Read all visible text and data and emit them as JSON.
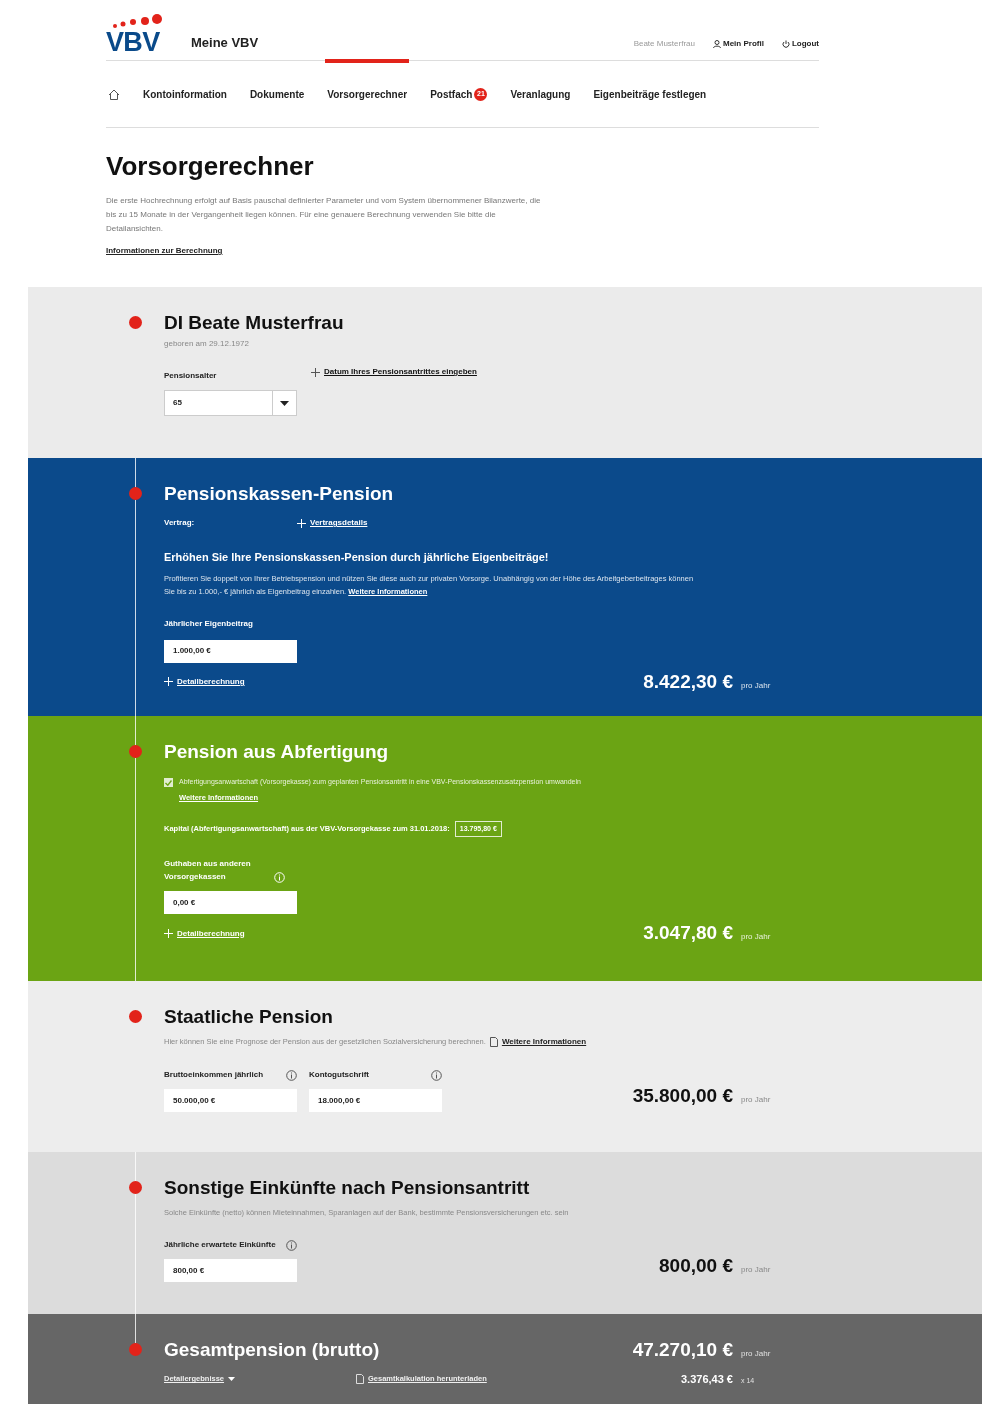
{
  "header": {
    "logo": "VBV",
    "app_title": "Meine VBV",
    "user_name": "Beate Musterfrau",
    "links": [
      {
        "kind": "profile",
        "label": "Mein Profil"
      },
      {
        "kind": "logout",
        "label": "Logout"
      }
    ]
  },
  "nav": [
    {
      "kind": "home",
      "selected": false
    },
    {
      "label": "Kontoinformation",
      "selected": false
    },
    {
      "label": "Dokumente",
      "selected": false
    },
    {
      "label": "Vorsorgerechner",
      "selected": true
    },
    {
      "label": "Postfach",
      "badge": "21",
      "selected": false
    },
    {
      "label": "Veranlagung",
      "selected": false
    },
    {
      "label": "Eigenbeiträge festlegen",
      "selected": false
    }
  ],
  "page": {
    "title": "Vorsorgerechner",
    "intro": "Die erste Hochrechnung erfolgt auf Basis pauschal definierter Parameter und vom System übernommener Bilanzwerte, die bis zu 15 Monate in der Vergangenheit liegen können. Für eine genauere Berechnung verwenden Sie bitte die Detailansichten.",
    "info_link": "Informationen zur Berechnung"
  },
  "sections": [
    {
      "kind": "person",
      "title": "DI Beate Musterfrau",
      "birth": "geboren am 29.12.1972",
      "age_label": "Pensionsalter",
      "age_value": "65",
      "date_link": "Datum Ihres Pensionsantrittes eingeben"
    },
    {
      "kind": "contract",
      "title": "Pensionskassen-Pension",
      "contract_label": "Vertrag:",
      "contract_link": "Vertragsdetails",
      "promo_title": "Erhöhen Sie Ihre Pensionskassen-Pension durch jährliche Eigenbeiträge!",
      "promo_text": "Profitieren Sie doppelt von Ihrer Betriebspension und nützen Sie diese auch zur privaten Vorsorge. Unabhängig von der Höhe des Arbeitgeberbeitrages können Sie bis zu 1.000,- € jährlich als Eigenbeitrag einzahlen.",
      "promo_link": "Weitere Informationen",
      "field_label": "Jährlicher Eigenbeitrag",
      "field_value": "1.000,00 €",
      "detail_link": "Detailberechnung",
      "amount": "8.422,30 €",
      "unit": "pro Jahr"
    },
    {
      "kind": "severance",
      "title": "Pension aus Abfertigung",
      "checked": true,
      "check_text": "Abfertigungsanwartschaft (Vorsorgekasse) zum geplanten Pensionsantritt in eine VBV-Pensionskassenzusatzpension umwandeln",
      "check_link": "Weitere Informationen",
      "capital_label": "Kapital (Abfertigungsanwartschaft) aus der VBV-Vorsorgekasse zum 31.01.2018:",
      "capital_value": "13.795,80 €",
      "field_label": "Guthaben aus anderen Vorsorgekassen",
      "field_value": "0,00 €",
      "detail_link": "Detailberechnung",
      "amount": "3.047,80 €",
      "unit": "pro Jahr"
    },
    {
      "kind": "state",
      "title": "Staatliche Pension",
      "text": "Hier können Sie eine Prognose der Pension aus der gesetzlichen Sozialversicherung berechnen.",
      "link": "Weitere Informationen",
      "fields": [
        {
          "label": "Bruttoeinkommen jährlich",
          "value": "50.000,00 €"
        },
        {
          "label": "Kontogutschrift",
          "value": "18.000,00 €"
        }
      ],
      "amount": "35.800,00 €",
      "unit": "pro Jahr"
    },
    {
      "kind": "other",
      "title": "Sonstige Einkünfte nach Pensionsantritt",
      "text": "Solche Einkünfte (netto) können Mieteinnahmen, Sparanlagen auf der Bank, bestimmte Pensionsversicherungen etc. sein",
      "fields": [
        {
          "label": "Jährliche erwartete Einkünfte",
          "value": "800,00 €"
        }
      ],
      "amount": "800,00 €",
      "unit": "pro Jahr"
    },
    {
      "kind": "total",
      "title": "Gesamtpension (brutto)",
      "details": "Detailergebnisse",
      "download": "Gesamtkalkulation herunterladen",
      "amount": "47.270,10 €",
      "unit": "pro Jahr",
      "monthly": "3.376,43 €",
      "monthly_unit": "x 14"
    }
  ]
}
